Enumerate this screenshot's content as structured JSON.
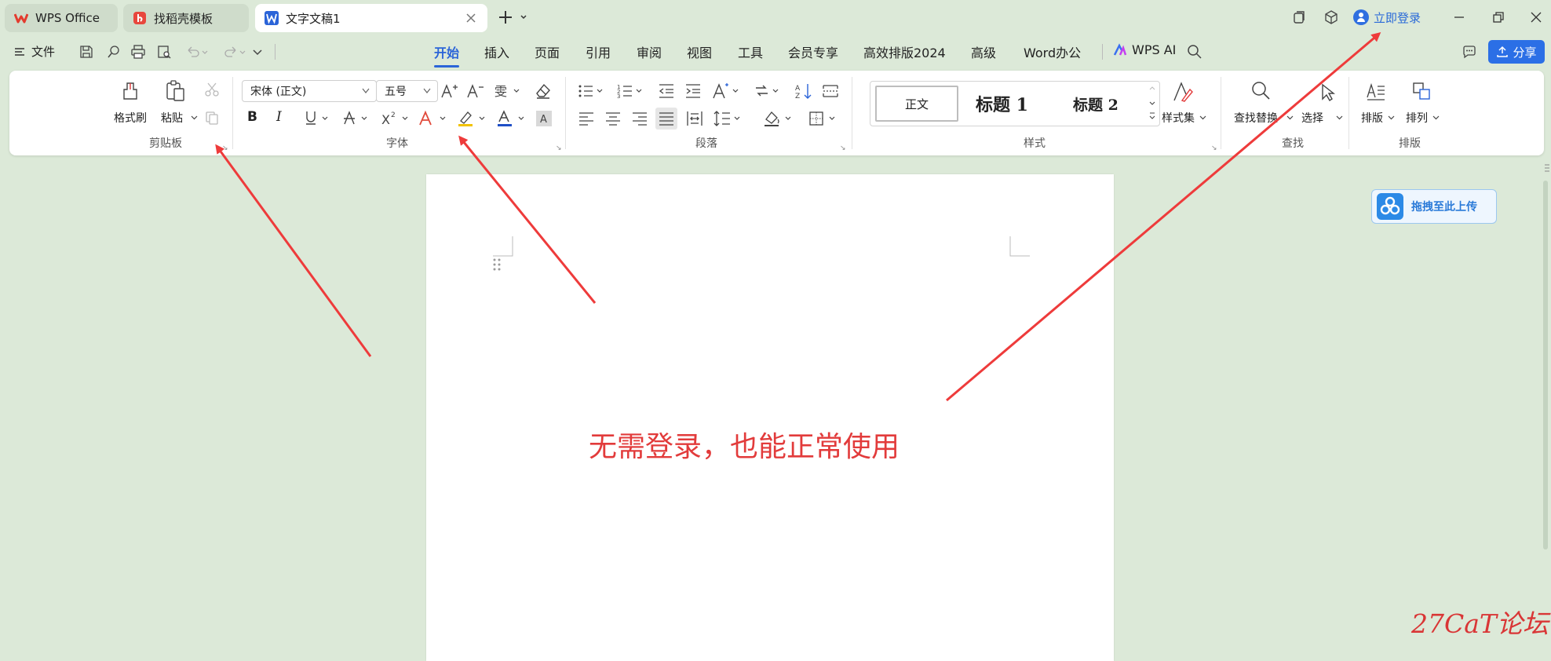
{
  "tabs": [
    {
      "label": "WPS Office",
      "icon": "wps-logo-icon"
    },
    {
      "label": "找稻壳模板",
      "icon": "docer-icon"
    },
    {
      "label": "文字文稿1",
      "icon": "word-doc-icon"
    }
  ],
  "titlebar": {
    "login_label": "立即登录"
  },
  "menu": {
    "file_label": "文件",
    "tabs": [
      "开始",
      "插入",
      "页面",
      "引用",
      "审阅",
      "视图",
      "工具",
      "会员专享",
      "高效排版2024",
      "高级",
      "Word办公"
    ],
    "active_tab": "开始",
    "ai_label": "WPS AI",
    "share_label": "分享"
  },
  "ribbon": {
    "clipboard": {
      "format_painter_label": "格式刷",
      "paste_label": "粘贴",
      "group_label": "剪贴板"
    },
    "font": {
      "font_name": "宋体 (正文)",
      "font_size": "五号",
      "group_label": "字体",
      "font_color": "#1f4fc7",
      "highlight_color": "#f2c300"
    },
    "paragraph": {
      "group_label": "段落"
    },
    "styles": {
      "normal_label": "正文",
      "h1_label": "标题 1",
      "h2_label": "标题 2",
      "style_set_label": "样式集",
      "group_label": "样式"
    },
    "find": {
      "find_replace_label": "查找替换",
      "select_label": "选择",
      "group_label": "查找"
    },
    "layout": {
      "arrange_label": "排版",
      "order_label": "排列",
      "group_label": "排版"
    }
  },
  "document": {
    "annotation_text": "无需登录，也能正常使用",
    "annotation_color": "#e23b3b"
  },
  "upload": {
    "label": "拖拽至此上传"
  },
  "watermark": "27CaT论坛"
}
